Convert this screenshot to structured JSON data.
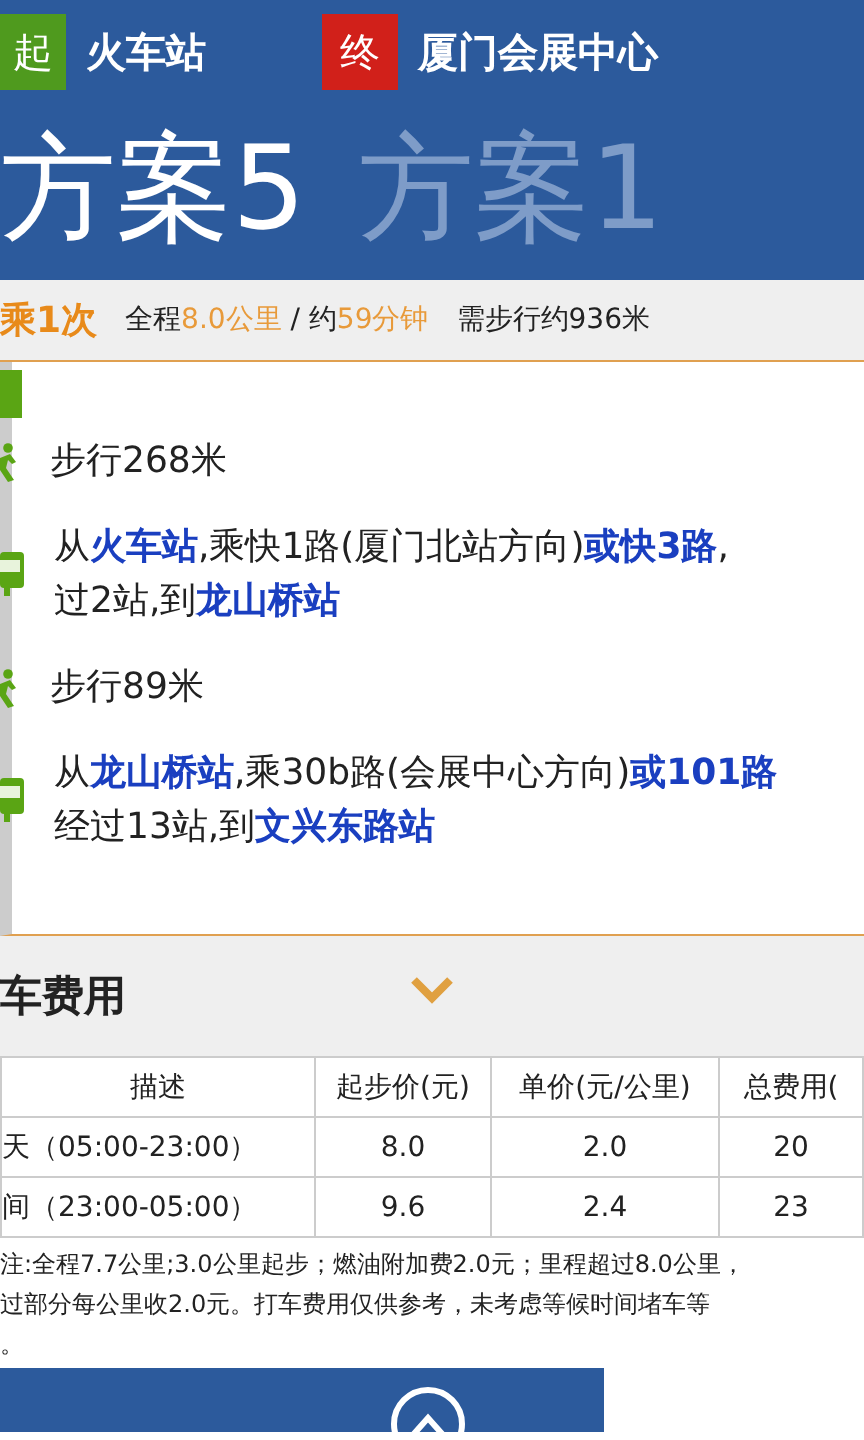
{
  "route": {
    "start_badge": "起",
    "start": "火车站",
    "end_badge": "终",
    "end": "厦门会展中心"
  },
  "plans": [
    {
      "label": "方案5",
      "selected": true
    },
    {
      "label": "方案1",
      "selected": false
    }
  ],
  "summary": {
    "transfers": "乘1次",
    "distance_prefix": "全程",
    "distance": "8.0公里",
    "sep": " / 约",
    "time": "59分钟",
    "walk": "需步行约936米"
  },
  "steps": [
    {
      "kind": "walk",
      "lines": [
        "步行268米"
      ]
    },
    {
      "kind": "bus",
      "lines": [
        "从**火车站**,乘快1路(厦门北站方向)**或快3路**,",
        "过2站,到**龙山桥站**"
      ]
    },
    {
      "kind": "walk",
      "lines": [
        "步行89米"
      ]
    },
    {
      "kind": "bus",
      "lines": [
        "从**龙山桥站**,乘30b路(会展中心方向)**或101路**",
        "经过13站,到**文兴东路站**"
      ]
    }
  ],
  "taxi": {
    "title": "车费用",
    "expanded": true,
    "columns": [
      "描述",
      "起步价(元)",
      "单价(元/公里)",
      "总费用("
    ],
    "rows": [
      [
        "天（05:00-23:00）",
        "8.0",
        "2.0",
        "20"
      ],
      [
        "间（23:00-05:00）",
        "9.6",
        "2.4",
        "23"
      ]
    ],
    "note": [
      "注:全程7.7公里;3.0公里起步；燃油附加费2.0元；里程超过8.0公里，",
      "过部分每公里收2.0元。打车费用仅供参考，未考虑等候时间堵车等",
      "。"
    ]
  }
}
